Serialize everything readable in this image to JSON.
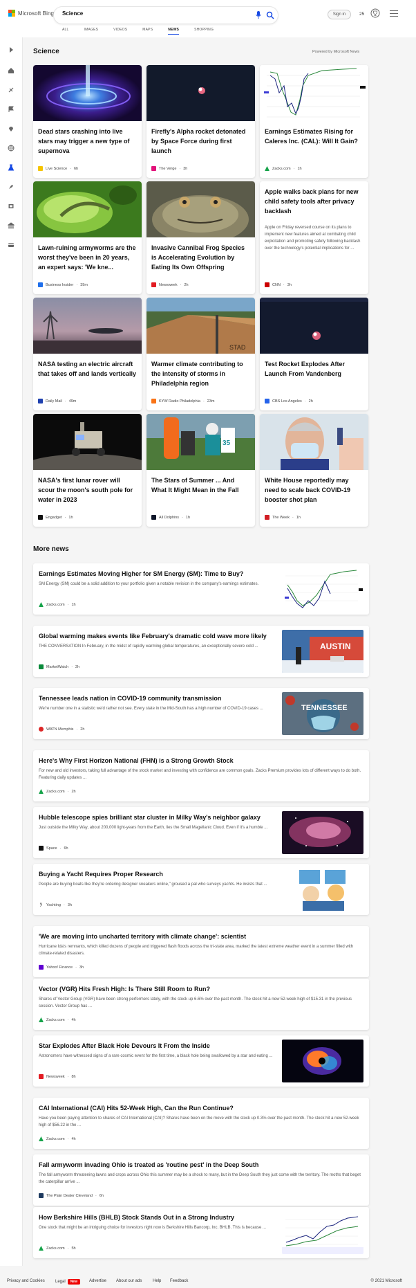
{
  "header": {
    "logo_text": "Microsoft Bing",
    "search_value": "Science",
    "sign_in": "Sign in",
    "rewards_count": "25",
    "tabs": [
      "ALL",
      "IMAGES",
      "VIDEOS",
      "MAPS",
      "NEWS",
      "SHOPPING"
    ],
    "active_tab": "NEWS"
  },
  "section": {
    "title": "Science",
    "powered": "Powered by Microsoft News"
  },
  "cards": [
    {
      "title": "Dead stars crashing into live stars may trigger a new type of supernova",
      "source": "Live Science",
      "time": "6h"
    },
    {
      "title": "Firefly's Alpha rocket detonated by Space Force during first launch",
      "source": "The Verge",
      "time": "3h"
    },
    {
      "title": "Earnings Estimates Rising for Caleres Inc. (CAL): Will It Gain?",
      "source": "Zacks.com",
      "time": "1h"
    },
    {
      "title": "Lawn-ruining armyworms are the worst they've been in 20 years, an expert says: 'We kne...",
      "source": "Business Insider",
      "time": "39m"
    },
    {
      "title": "Invasive Cannibal Frog Species is Accelerating Evolution by Eating Its Own Offspring",
      "source": "Newsweek",
      "time": "2h"
    },
    {
      "title": "Apple walks back plans for new child safety tools after privacy backlash",
      "snippet": "Apple on Friday reversed course on its plans to implement new features aimed at combating child exploitation and promoting safety following backlash over the technology's potential implications for ...",
      "source": "CNN",
      "time": "3h"
    },
    {
      "title": "NASA testing an electric aircraft that takes off and lands vertically",
      "source": "Daily Mail",
      "time": "49m"
    },
    {
      "title": "Warmer climate contributing to the intensity of storms in Philadelphia region",
      "source": "KYW Radio Philadelphia",
      "time": "23m"
    },
    {
      "title": "Test Rocket Explodes After Launch From Vandenberg",
      "source": "CBS Los Angeles",
      "time": "2h"
    },
    {
      "title": "NASA's first lunar rover will scour the moon's south pole for water in 2023",
      "source": "Engadget",
      "time": "1h"
    },
    {
      "title": "The Stars of Summer ... And What It Might Mean in the Fall",
      "source": "All Dolphins",
      "time": "1h"
    },
    {
      "title": "White House reportedly may need to scale back COVID-19 booster shot plan",
      "source": "The Week",
      "time": "1h"
    }
  ],
  "more_news": {
    "title": "More news",
    "items": [
      {
        "title": "Earnings Estimates Moving Higher for SM Energy (SM): Time to Buy?",
        "snippet": "SM Energy (SM) could be a solid addition to your portfolio given a notable revision in the company's earnings estimates.",
        "source": "Zacks.com",
        "time": "1h"
      },
      {
        "title": "Global warming makes events like February's dramatic cold wave more likely",
        "snippet": "THE CONVERSATION In February, in the midst of rapidly warming global temperatures, an exceptionally severe cold ...",
        "source": "MarketWatch",
        "time": "2h"
      },
      {
        "title": "Tennessee leads nation in COVID-19 community transmission",
        "snippet": "We're number one in a statistic we'd rather not see. Every state in the Mid-South has a high number of COVID-19 cases ...",
        "source": "WATN Memphis",
        "time": "2h"
      },
      {
        "title": "Here's Why First Horizon National (FHN) is a Strong Growth Stock",
        "snippet": "For new and old investors, taking full advantage of the stock market and investing with confidence are common goals. Zacks Premium provides lots of different ways to do both. Featuring daily updates ...",
        "source": "Zacks.com",
        "time": "2h"
      },
      {
        "title": "Hubble telescope spies brilliant star cluster in Milky Way's neighbor galaxy",
        "snippet": "Just outside the Milky Way, about 200,000 light-years from the Earth, lies the Small Magellanic Cloud. Even if it's a humble ...",
        "source": "Space",
        "time": "6h"
      },
      {
        "title": "Buying a Yacht Requires Proper Research",
        "snippet": "People are buying boats like they're ordering designer sneakers online,\" groused a pal who surveys yachts. He insists that ...",
        "source": "Yachting",
        "time": "3h"
      },
      {
        "title": "'We are moving into uncharted territory with climate change': scientist",
        "snippet": "Hurricane Ida's remnants, which killed dozens of people and triggered flash floods across the tri-state area, marked the latest extreme weather event in a summer filled with climate-related disasters.",
        "source": "Yahoo! Finance",
        "time": "3h"
      },
      {
        "title": "Vector (VGR) Hits Fresh High: Is There Still Room to Run?",
        "snippet": "Shares of Vector Group (VGR) have been strong performers lately, with the stock up 6.6% over the past month. The stock hit a new 52-week high of $15.31 in the previous session. Vector Group has ...",
        "source": "Zacks.com",
        "time": "4h"
      },
      {
        "title": "Star Explodes After Black Hole Devours It From the Inside",
        "snippet": "Astronomers have witnessed signs of a rare cosmic event for the first time, a black hole being swallowed by a star and eating ...",
        "source": "Newsweek",
        "time": "8h"
      },
      {
        "title": "CAI International (CAI) Hits 52-Week High, Can the Run Continue?",
        "snippet": "Have you been paying attention to shares of CAI International (CAI)? Shares have been on the move with the stock up 0.3% over the past month. The stock hit a new 52-week high of $56.22 in the ...",
        "source": "Zacks.com",
        "time": "4h"
      },
      {
        "title": "Fall armyworm invading Ohio is treated as 'routine pest' in the Deep South",
        "snippet": "The fall armyworm threatening lawns and crops across Ohio this summer may be a shock to many, but in the Deep South they just come with the territory. The moths that beget the caterpillar arrive ...",
        "source": "The Plain Dealer Cleveland",
        "time": "6h"
      },
      {
        "title": "How Berkshire Hills (BHLB) Stock Stands Out in a Strong Industry",
        "snippet": "One stock that might be an intriguing choice for investors right now is Berkshire Hills Bancorp, Inc. BHLB. This is because ...",
        "source": "Zacks.com",
        "time": "5h"
      }
    ]
  },
  "footer": {
    "links": [
      "Privacy and Cookies",
      "Legal",
      "Advertise",
      "About our ads",
      "Help",
      "Feedback"
    ],
    "new_badge": "New",
    "copyright": "© 2021 Microsoft"
  },
  "colors": {
    "accent": "#174ae4",
    "zacks": "#16a34a",
    "cnn": "#cc0000",
    "newsweek": "#e21b22"
  }
}
